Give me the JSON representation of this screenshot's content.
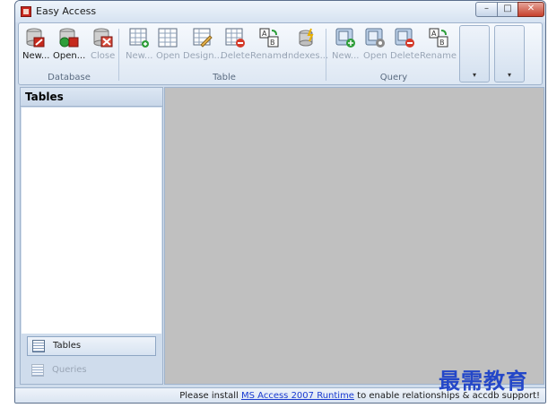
{
  "window": {
    "title": "Easy Access",
    "controls": {
      "minimize": "–",
      "maximize": "□",
      "close": "✕"
    }
  },
  "ribbon": {
    "database": {
      "label": "Database",
      "buttons": [
        {
          "label": "New...",
          "icon": "db-new-icon",
          "enabled": true
        },
        {
          "label": "Open...",
          "icon": "db-open-icon",
          "enabled": true
        },
        {
          "label": "Close",
          "icon": "db-close-icon",
          "enabled": false
        }
      ]
    },
    "table": {
      "label": "Table",
      "buttons": [
        {
          "label": "New...",
          "icon": "table-new-icon",
          "enabled": false
        },
        {
          "label": "Open",
          "icon": "table-open-icon",
          "enabled": false
        },
        {
          "label": "Design...",
          "icon": "table-design-icon",
          "enabled": false
        },
        {
          "label": "Delete",
          "icon": "table-delete-icon",
          "enabled": false
        },
        {
          "label": "Rename",
          "icon": "table-rename-icon",
          "enabled": false
        },
        {
          "label": "Indexes...",
          "icon": "table-indexes-icon",
          "enabled": false
        }
      ]
    },
    "query": {
      "label": "Query",
      "buttons": [
        {
          "label": "New...",
          "icon": "query-new-icon",
          "enabled": false
        },
        {
          "label": "Open",
          "icon": "query-open-icon",
          "enabled": false
        },
        {
          "label": "Delete",
          "icon": "query-delete-icon",
          "enabled": false
        },
        {
          "label": "Rename",
          "icon": "query-rename-icon",
          "enabled": false
        }
      ]
    },
    "dropdown_arrow": "▾"
  },
  "sidebar": {
    "header": "Tables",
    "nav": [
      {
        "label": "Tables",
        "icon": "tables-icon",
        "enabled": true
      },
      {
        "label": "Queries",
        "icon": "queries-icon",
        "enabled": false
      }
    ]
  },
  "statusbar": {
    "prefix": "Please install",
    "link": "MS Access 2007 Runtime",
    "suffix": "to enable relationships & accdb support!"
  },
  "watermark": "最需教育",
  "colors": {
    "accent": "#1a3bd1",
    "workspace": "#c0c0c0",
    "chrome": "#cfdcec"
  }
}
